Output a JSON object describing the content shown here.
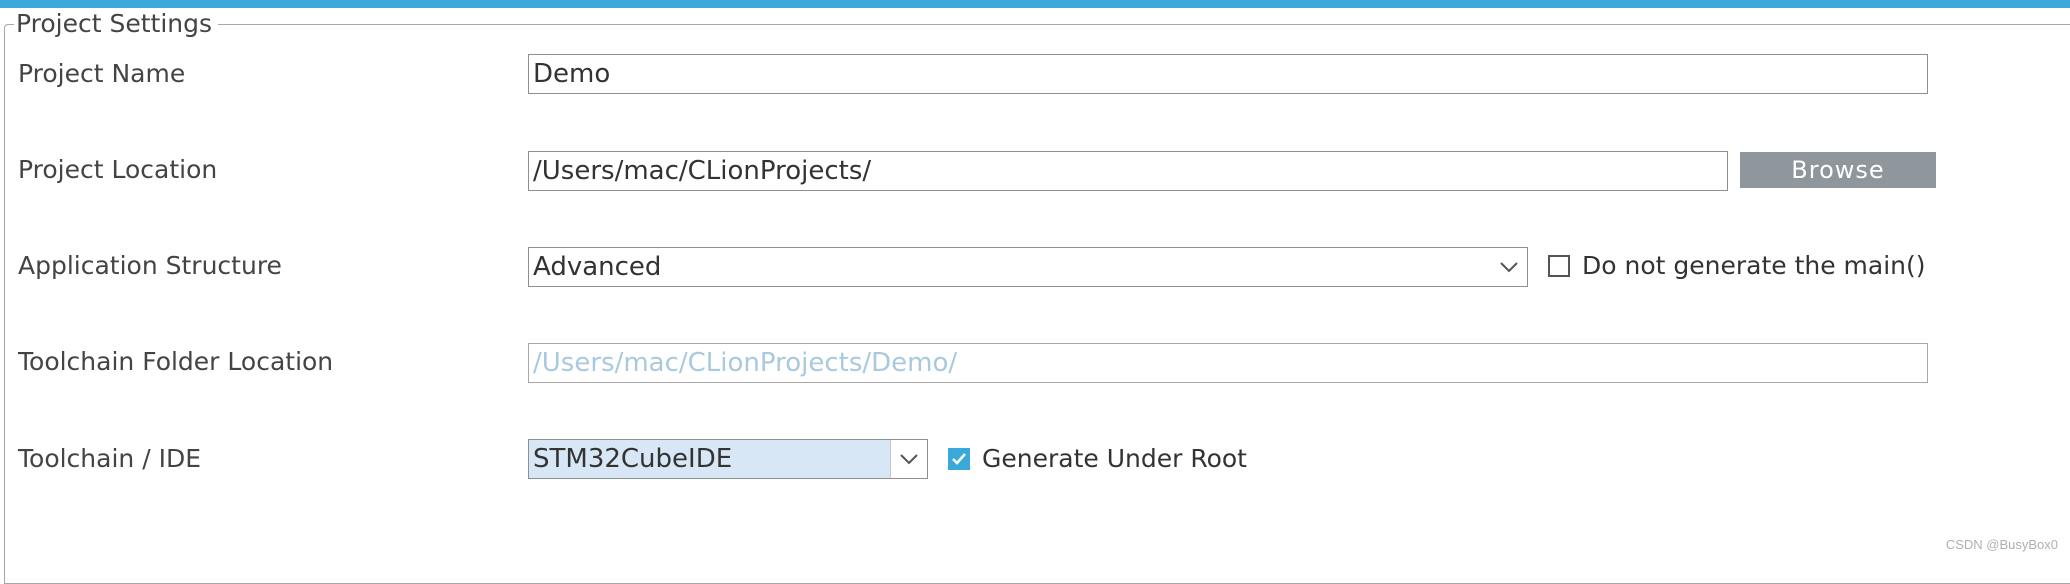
{
  "group": {
    "title": "Project Settings"
  },
  "rows": {
    "project_name": {
      "label": "Project Name",
      "value": "Demo"
    },
    "project_location": {
      "label": "Project Location",
      "value": "/Users/mac/CLionProjects/",
      "browse_label": "Browse"
    },
    "application_structure": {
      "label": "Application Structure",
      "value": "Advanced",
      "checkbox_label": "Do not generate the main()",
      "checkbox_checked": false
    },
    "toolchain_folder": {
      "label": "Toolchain Folder Location",
      "value": "/Users/mac/CLionProjects/Demo/"
    },
    "toolchain_ide": {
      "label": "Toolchain / IDE",
      "value": "STM32CubeIDE",
      "checkbox_label": "Generate Under Root",
      "checkbox_checked": true
    }
  },
  "watermark": "CSDN @BusyBox0",
  "colors": {
    "accent": "#3aa8d8",
    "button": "#8f979d",
    "selected_combo": "#d7e7f5",
    "disabled_text": "#a9c9df"
  },
  "icons": {
    "combo_arrow": "chevron-down-icon",
    "check": "check-icon"
  }
}
